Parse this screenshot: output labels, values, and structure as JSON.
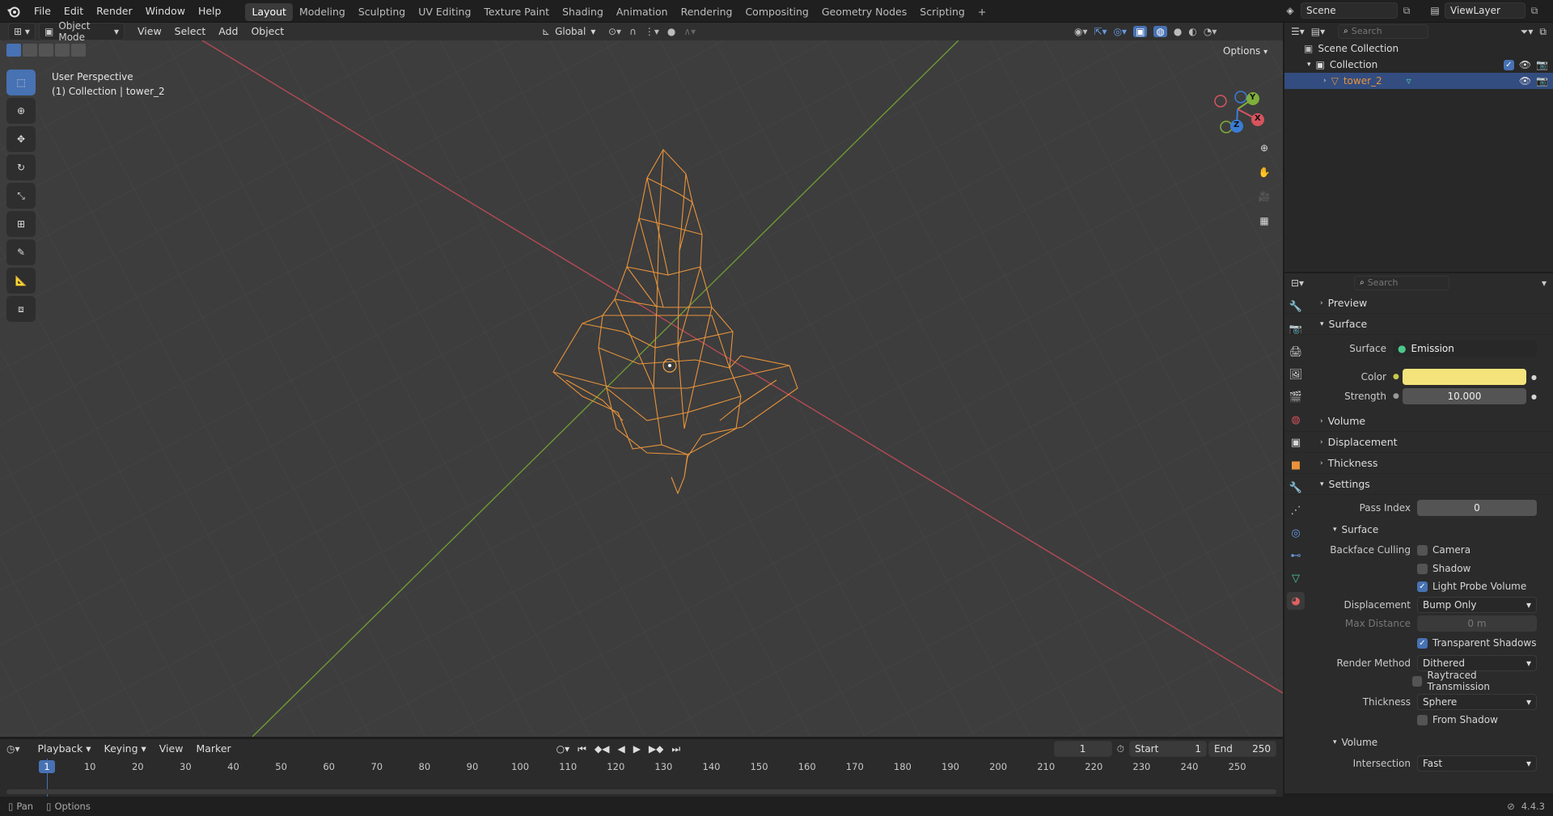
{
  "topbar": {
    "menus": [
      "File",
      "Edit",
      "Render",
      "Window",
      "Help"
    ],
    "workspaces": [
      "Layout",
      "Modeling",
      "Sculpting",
      "UV Editing",
      "Texture Paint",
      "Shading",
      "Animation",
      "Rendering",
      "Compositing",
      "Geometry Nodes",
      "Scripting"
    ],
    "add_tab": "+",
    "scene_label": "Scene",
    "viewlayer_label": "ViewLayer"
  },
  "viewport_header": {
    "mode": "Object Mode",
    "menus": [
      "View",
      "Select",
      "Add",
      "Object"
    ],
    "transform": "Global",
    "options": "Options"
  },
  "viewport": {
    "perspective": "User Perspective",
    "collection_info": "(1) Collection | tower_2",
    "gizmo_labels": {
      "y": "Y",
      "x": "X",
      "z": "Z"
    }
  },
  "outliner": {
    "search_placeholder": "Search",
    "scene_collection": "Scene Collection",
    "collection": "Collection",
    "object": "tower_2"
  },
  "properties": {
    "search_placeholder": "Search",
    "preview": "Preview",
    "surface_panel": "Surface",
    "surface_label": "Surface",
    "surface_value": "Emission",
    "color_label": "Color",
    "color_value": "#f3e37a",
    "strength_label": "Strength",
    "strength_value": "10.000",
    "volume": "Volume",
    "displacement": "Displacement",
    "thickness": "Thickness",
    "settings": "Settings",
    "pass_index_label": "Pass Index",
    "pass_index_value": "0",
    "surface_sub": "Surface",
    "backface_culling": "Backface Culling",
    "camera": "Camera",
    "shadow": "Shadow",
    "light_probe_volume": "Light Probe Volume",
    "displacement_label": "Displacement",
    "displacement_value": "Bump Only",
    "max_distance_label": "Max Distance",
    "max_distance_value": "0 m",
    "transparent_shadows": "Transparent Shadows",
    "render_method_label": "Render Method",
    "render_method_value": "Dithered",
    "raytraced_transmission": "Raytraced Transmission",
    "thickness_label": "Thickness",
    "thickness_value": "Sphere",
    "from_shadow": "From Shadow",
    "volume_sub": "Volume",
    "intersection_label": "Intersection",
    "intersection_value": "Fast"
  },
  "timeline": {
    "menus": [
      "Playback",
      "Keying",
      "View",
      "Marker"
    ],
    "current_frame": "1",
    "start_label": "Start",
    "start_value": "1",
    "end_label": "End",
    "end_value": "250",
    "playhead": "1",
    "ticks": [
      "10",
      "20",
      "30",
      "40",
      "50",
      "60",
      "70",
      "80",
      "90",
      "100",
      "110",
      "120",
      "130",
      "140",
      "150",
      "160",
      "170",
      "180",
      "190",
      "200",
      "210",
      "220",
      "230",
      "240",
      "250"
    ]
  },
  "statusbar": {
    "pan": "Pan",
    "options": "Options",
    "version": "4.4.3"
  },
  "colors": {
    "accent": "#4772b3",
    "wire": "#e8933a",
    "x_axis": "#d6545e",
    "y_axis": "#7fae3b",
    "z_axis": "#3a7dd6"
  }
}
